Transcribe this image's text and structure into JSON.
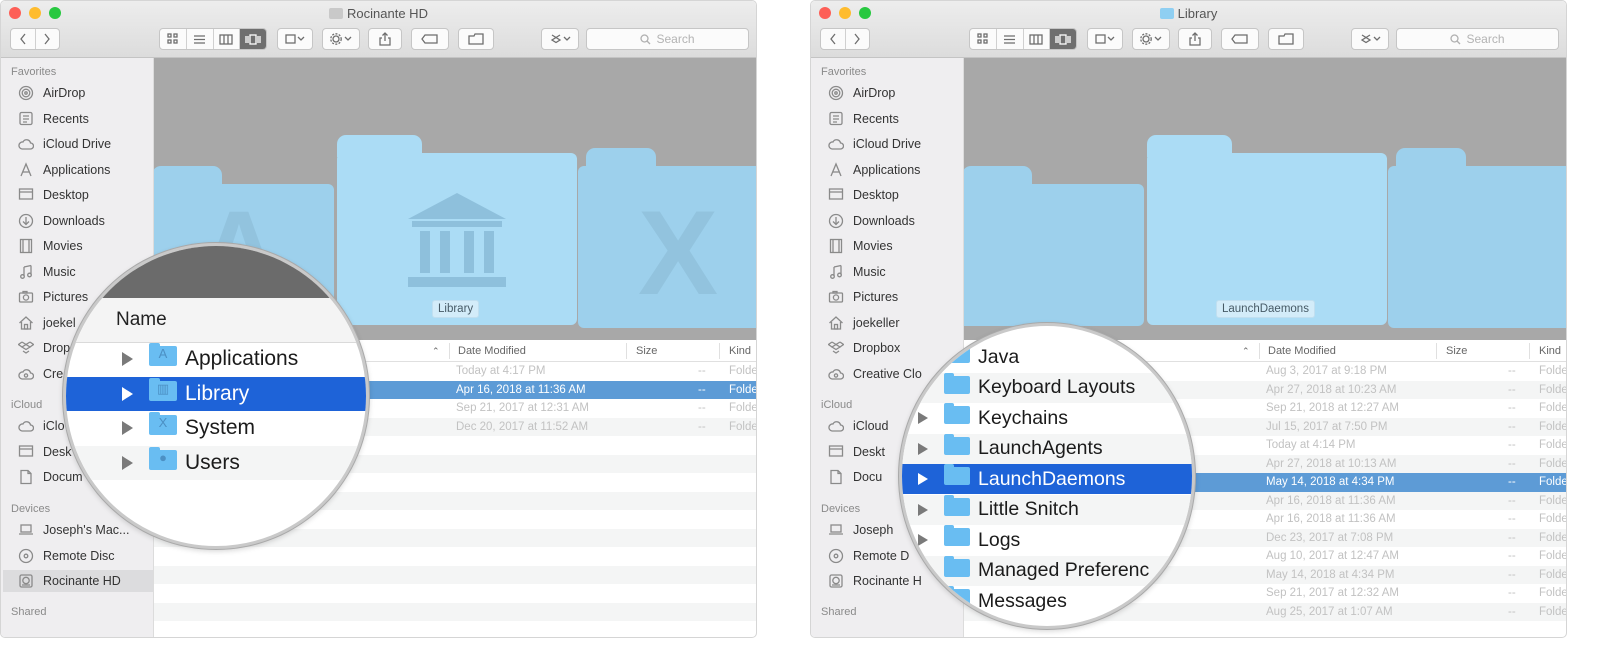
{
  "left": {
    "title": "Rocinante HD",
    "search_placeholder": "Search",
    "sidebar": {
      "favorites_label": "Favorites",
      "favorites": [
        {
          "label": "AirDrop",
          "icon": "airdrop-icon"
        },
        {
          "label": "Recents",
          "icon": "recents-icon"
        },
        {
          "label": "iCloud Drive",
          "icon": "cloud-icon"
        },
        {
          "label": "Applications",
          "icon": "applications-icon"
        },
        {
          "label": "Desktop",
          "icon": "desktop-icon"
        },
        {
          "label": "Downloads",
          "icon": "downloads-icon"
        },
        {
          "label": "Movies",
          "icon": "movies-icon"
        },
        {
          "label": "Music",
          "icon": "music-icon"
        },
        {
          "label": "Pictures",
          "icon": "camera-icon"
        },
        {
          "label": "joekel",
          "icon": "home-icon"
        },
        {
          "label": "Drop",
          "icon": "dropbox-icon"
        },
        {
          "label": "Cre",
          "icon": "creative-cloud-icon"
        }
      ],
      "icloud_label": "iCloud",
      "icloud": [
        {
          "label": "iClo",
          "icon": "cloud-icon"
        },
        {
          "label": "Desk",
          "icon": "desktop-icon"
        },
        {
          "label": "Docum",
          "icon": "document-icon"
        }
      ],
      "devices_label": "Devices",
      "devices": [
        {
          "label": "Joseph's Mac...",
          "icon": "laptop-icon"
        },
        {
          "label": "Remote Disc",
          "icon": "disc-icon"
        },
        {
          "label": "Rocinante HD",
          "icon": "harddisk-icon"
        }
      ],
      "shared_label": "Shared"
    },
    "coverflow_label": "Library",
    "columns": {
      "date": "Date Modified",
      "size": "Size",
      "kind": "Kind"
    },
    "rows": [
      {
        "date": "Today at 4:17 PM",
        "size": "--",
        "kind": "Folde"
      },
      {
        "date": "Apr 16, 2018 at 11:36 AM",
        "size": "--",
        "kind": "Folde"
      },
      {
        "date": "Sep 21, 2017 at 12:31 AM",
        "size": "--",
        "kind": "Folde"
      },
      {
        "date": "Dec 20, 2017 at 11:52 AM",
        "size": "--",
        "kind": "Folde"
      }
    ],
    "magnifier": {
      "header": "Name",
      "items": [
        {
          "label": "Applications",
          "glyph": "A"
        },
        {
          "label": "Library",
          "glyph": "▥"
        },
        {
          "label": "System",
          "glyph": "X"
        },
        {
          "label": "Users",
          "glyph": "●"
        }
      ]
    }
  },
  "right": {
    "title": "Library",
    "search_placeholder": "Search",
    "sidebar": {
      "favorites_label": "Favorites",
      "favorites": [
        {
          "label": "AirDrop",
          "icon": "airdrop-icon"
        },
        {
          "label": "Recents",
          "icon": "recents-icon"
        },
        {
          "label": "iCloud Drive",
          "icon": "cloud-icon"
        },
        {
          "label": "Applications",
          "icon": "applications-icon"
        },
        {
          "label": "Desktop",
          "icon": "desktop-icon"
        },
        {
          "label": "Downloads",
          "icon": "downloads-icon"
        },
        {
          "label": "Movies",
          "icon": "movies-icon"
        },
        {
          "label": "Music",
          "icon": "music-icon"
        },
        {
          "label": "Pictures",
          "icon": "camera-icon"
        },
        {
          "label": "joekeller",
          "icon": "home-icon"
        },
        {
          "label": "Dropbox",
          "icon": "dropbox-icon"
        },
        {
          "label": "Creative Clo",
          "icon": "creative-cloud-icon"
        }
      ],
      "icloud_label": "iCloud",
      "icloud": [
        {
          "label": "iCloud",
          "icon": "cloud-icon"
        },
        {
          "label": "Deskt",
          "icon": "desktop-icon"
        },
        {
          "label": "Docu",
          "icon": "document-icon"
        }
      ],
      "devices_label": "Devices",
      "devices": [
        {
          "label": "Joseph",
          "icon": "laptop-icon"
        },
        {
          "label": "Remote D",
          "icon": "disc-icon"
        },
        {
          "label": "Rocinante H",
          "icon": "harddisk-icon"
        }
      ],
      "shared_label": "Shared"
    },
    "coverflow_label": "LaunchDaemons",
    "columns": {
      "date": "Date Modified",
      "size": "Size",
      "kind": "Kind"
    },
    "rows": [
      {
        "date": "Aug 3, 2017 at 9:18 PM",
        "size": "--",
        "kind": "Folde"
      },
      {
        "date": "Apr 27, 2018 at 10:23 AM",
        "size": "--",
        "kind": "Folde"
      },
      {
        "date": "Sep 21, 2018 at 12:27 AM",
        "size": "--",
        "kind": "Folde"
      },
      {
        "date": "Jul 15, 2017 at 7:50 PM",
        "size": "--",
        "kind": "Folde"
      },
      {
        "date": "Today at 4:14 PM",
        "size": "--",
        "kind": "Folde"
      },
      {
        "date": "Apr 27, 2018 at 10:13 AM",
        "size": "--",
        "kind": "Folde"
      },
      {
        "date": "May 14, 2018 at 4:34 PM",
        "size": "--",
        "kind": "Folde"
      },
      {
        "date": "Apr 16, 2018 at 11:36 AM",
        "size": "--",
        "kind": "Folde"
      },
      {
        "date": "Apr 16, 2018 at 11:36 AM",
        "size": "--",
        "kind": "Folde"
      },
      {
        "date": "Dec 23, 2017 at 7:08 PM",
        "size": "--",
        "kind": "Folde"
      },
      {
        "date": "Aug 10, 2017 at 12:47 AM",
        "size": "--",
        "kind": "Folde"
      },
      {
        "date": "May 14, 2018 at 4:34 PM",
        "size": "--",
        "kind": "Folde"
      },
      {
        "date": "Sep 21, 2017 at 12:32 AM",
        "size": "--",
        "kind": "Folde"
      },
      {
        "date": "Aug 25, 2017 at 1:07 AM",
        "size": "--",
        "kind": "Folde"
      }
    ],
    "magnifier": {
      "items": [
        {
          "label": "Java",
          "arrow": false
        },
        {
          "label": "Keyboard Layouts",
          "arrow": true
        },
        {
          "label": "Keychains",
          "arrow": true
        },
        {
          "label": "LaunchAgents",
          "arrow": true
        },
        {
          "label": "LaunchDaemons",
          "arrow": true
        },
        {
          "label": "Little Snitch",
          "arrow": true
        },
        {
          "label": "Logs",
          "arrow": true
        },
        {
          "label": "Managed Preferenc",
          "arrow": true
        },
        {
          "label": "Messages",
          "arrow": false
        }
      ]
    }
  }
}
